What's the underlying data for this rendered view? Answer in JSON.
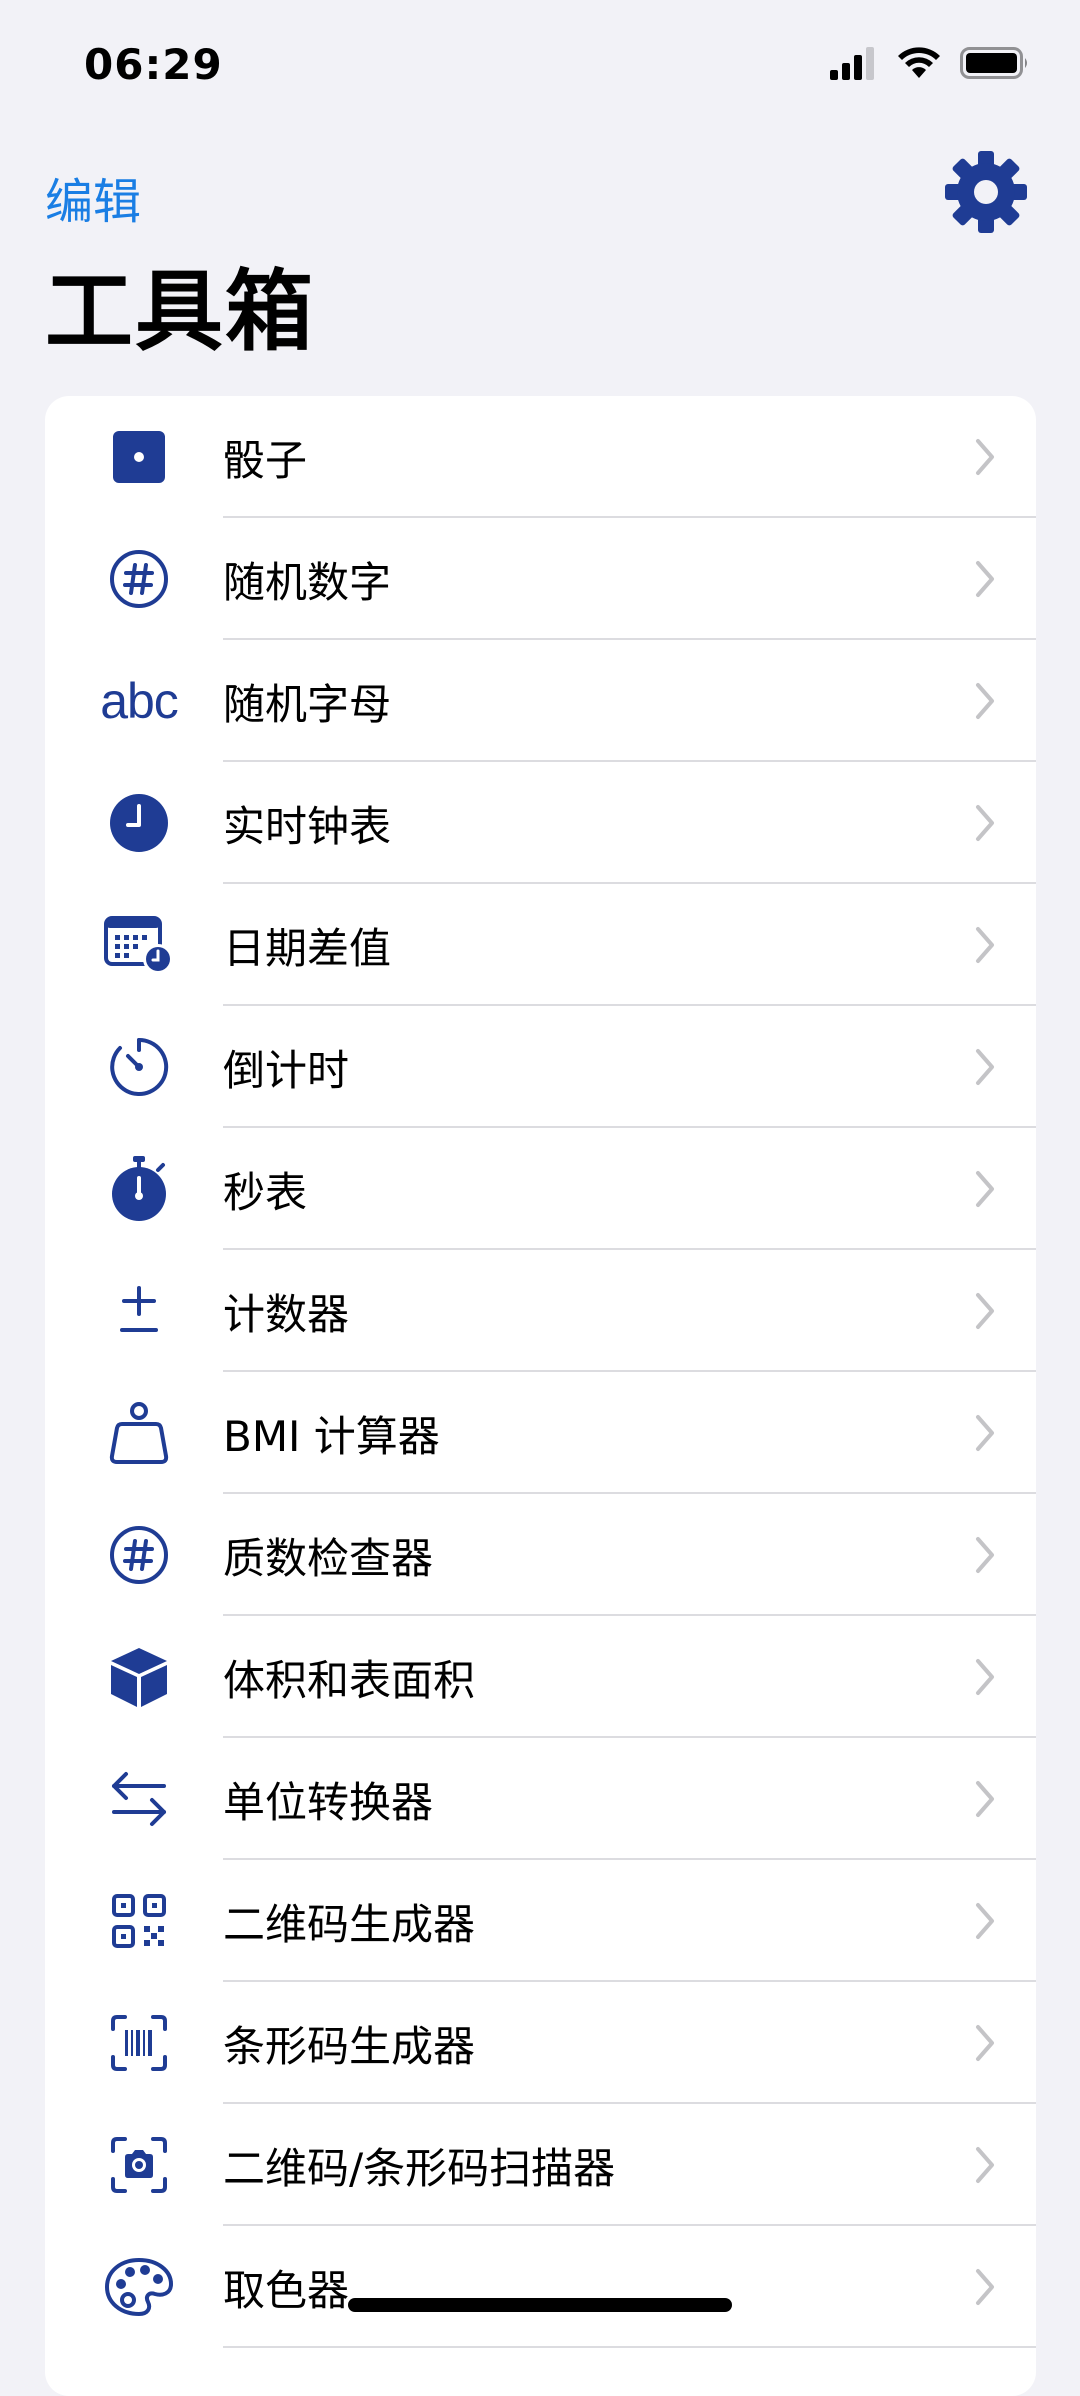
{
  "status_bar": {
    "time": "06:29"
  },
  "nav": {
    "edit_label": "编辑",
    "settings_icon": "gear-icon"
  },
  "page": {
    "title": "工具箱"
  },
  "colors": {
    "accent_icon": "#1f3c94",
    "link_blue": "#1a7ee4",
    "background": "#f2f2f7",
    "chevron": "#c4c4c7"
  },
  "tools": [
    {
      "label": "骰子",
      "icon": "die-icon"
    },
    {
      "label": "随机数字",
      "icon": "number-circle-icon"
    },
    {
      "label": "随机字母",
      "icon": "abc-icon",
      "icon_text": "abc"
    },
    {
      "label": "实时钟表",
      "icon": "clock-icon"
    },
    {
      "label": "日期差值",
      "icon": "calendar-clock-icon"
    },
    {
      "label": "倒计时",
      "icon": "timer-icon"
    },
    {
      "label": "秒表",
      "icon": "stopwatch-icon"
    },
    {
      "label": "计数器",
      "icon": "plus-minus-icon"
    },
    {
      "label": "BMI 计算器",
      "icon": "scale-weight-icon"
    },
    {
      "label": "质数检查器",
      "icon": "number-circle-icon"
    },
    {
      "label": "体积和表面积",
      "icon": "cube-icon"
    },
    {
      "label": "单位转换器",
      "icon": "arrows-swap-icon"
    },
    {
      "label": "二维码生成器",
      "icon": "qr-code-icon"
    },
    {
      "label": "条形码生成器",
      "icon": "barcode-viewfinder-icon"
    },
    {
      "label": "二维码/条形码扫描器",
      "icon": "camera-viewfinder-icon"
    },
    {
      "label": "取色器",
      "icon": "palette-icon"
    }
  ]
}
